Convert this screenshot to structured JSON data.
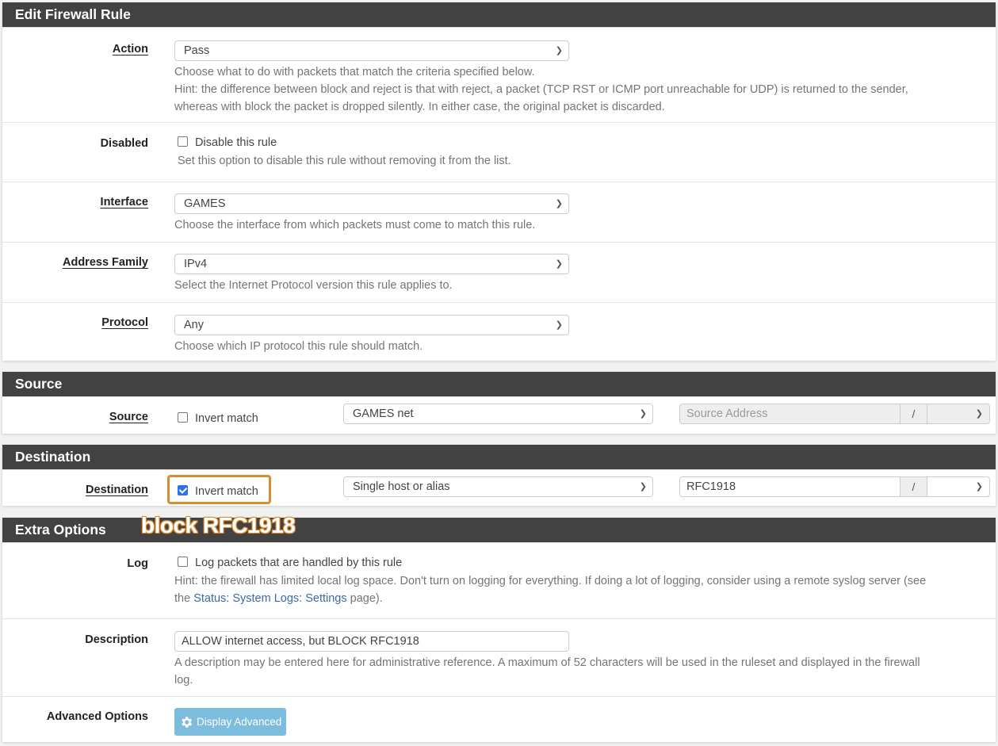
{
  "panels": {
    "edit_rule": {
      "title": "Edit Firewall Rule",
      "action": {
        "label": "Action",
        "value": "Pass",
        "help": "Choose what to do with packets that match the criteria specified below.",
        "hint1": "Hint: the difference between block and reject is that with reject, a packet (TCP RST or ICMP port unreachable for UDP) is returned to the sender,",
        "hint2": "whereas with block the packet is dropped silently. In either case, the original packet is discarded."
      },
      "disabled": {
        "label": "Disabled",
        "checkbox_label": "Disable this rule",
        "checked": false,
        "help": "Set this option to disable this rule without removing it from the list."
      },
      "interface": {
        "label": "Interface",
        "value": "GAMES",
        "help": "Choose the interface from which packets must come to match this rule."
      },
      "address_family": {
        "label": "Address Family",
        "value": "IPv4",
        "help": "Select the Internet Protocol version this rule applies to."
      },
      "protocol": {
        "label": "Protocol",
        "value": "Any",
        "help": "Choose which IP protocol this rule should match."
      }
    },
    "source": {
      "title": "Source",
      "label": "Source",
      "invert_label": "Invert match",
      "invert_checked": false,
      "type_value": "GAMES net",
      "address_placeholder": "Source Address",
      "slash": "/",
      "mask_value": ""
    },
    "destination": {
      "title": "Destination",
      "label": "Destination",
      "invert_label": "Invert match",
      "invert_checked": true,
      "type_value": "Single host or alias",
      "address_value": "RFC1918",
      "slash": "/",
      "mask_value": ""
    },
    "extra": {
      "title": "Extra Options",
      "log": {
        "label": "Log",
        "checkbox_label": "Log packets that are handled by this rule",
        "checked": false,
        "hint_line1": "Hint: the firewall has limited local log space. Don't turn on logging for everything. If doing a lot of logging, consider using a remote syslog server (see",
        "hint_pre": "the ",
        "hint_link": "Status: System Logs: Settings",
        "hint_post": " page)."
      },
      "description": {
        "label": "Description",
        "value": "ALLOW internet access, but BLOCK RFC1918",
        "help_line1": "A description may be entered here for administrative reference. A maximum of 52 characters will be used in the ruleset and displayed in the firewall",
        "help_line2": "log."
      },
      "advanced": {
        "label": "Advanced Options",
        "button_label": "Display Advanced",
        "button_icon": "gear-icon"
      }
    }
  },
  "annotation": {
    "text": "block RFC1918",
    "color": "#e08a2e"
  },
  "colors": {
    "header_bg": "#424242",
    "button_bg": "#7cbcdc",
    "checkbox_checked": "#2b72e6",
    "link": "#3a6aa6"
  }
}
